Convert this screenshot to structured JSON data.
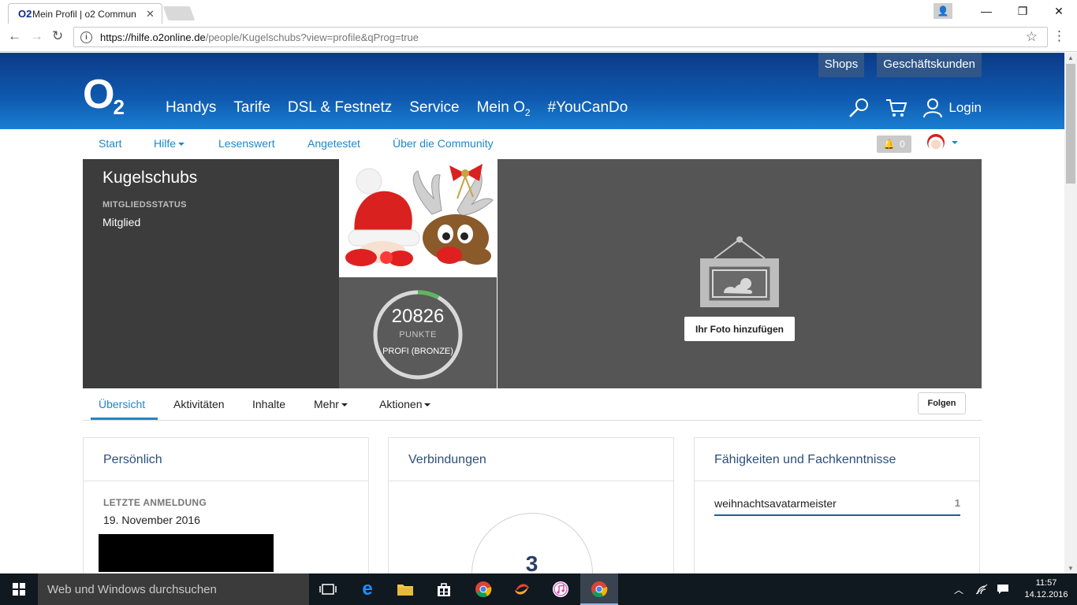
{
  "browser": {
    "tab_title": "Mein Profil | o2 Commun",
    "tab_favicon": "O2",
    "url_host": "https://hilfe.o2online.de",
    "url_path": "/people/Kugelschubs?view=profile&qProg=true"
  },
  "header": {
    "top_links": [
      "Shops",
      "Geschäftskunden"
    ],
    "logo": "O",
    "logo_sub": "2",
    "nav": [
      "Handys",
      "Tarife",
      "DSL & Festnetz",
      "Service",
      "Mein O",
      "#YouCanDo"
    ],
    "nav_mein_sub": "2",
    "login": "Login"
  },
  "subnav": {
    "items": [
      "Start",
      "Hilfe",
      "Lesenswert",
      "Angetestet",
      "Über die Community"
    ],
    "notification_count": "0"
  },
  "profile": {
    "name": "Kugelschubs",
    "status_label": "MITGLIEDSSTATUS",
    "status_value": "Mitglied",
    "points": "20826",
    "points_label": "PUNKTE",
    "rank": "PROFI (BRONZE)",
    "rank_progress": 0.08,
    "add_photo": "Ihr Foto hinzufügen"
  },
  "tabs": {
    "items": [
      "Übersicht",
      "Aktivitäten",
      "Inhalte",
      "Mehr",
      "Aktionen"
    ],
    "follow": "Folgen"
  },
  "cards": {
    "personal_title": "Persönlich",
    "last_login_label": "LETZTE ANMELDUNG",
    "last_login_value": "19. November 2016",
    "connections_title": "Verbindungen",
    "connections_count": "3",
    "skills_title": "Fähigkeiten und Fachkenntnisse",
    "skill_name": "weihnachtsavatarmeister",
    "skill_count": "1"
  },
  "taskbar": {
    "search_placeholder": "Web und Windows durchsuchen",
    "time": "11:57",
    "date": "14.12.2016"
  },
  "colors": {
    "o2_blue_dark": "#0c3a86",
    "o2_blue_light": "#1a7fd1",
    "link_blue": "#1f87c9",
    "progress_green": "#5cb85c"
  }
}
